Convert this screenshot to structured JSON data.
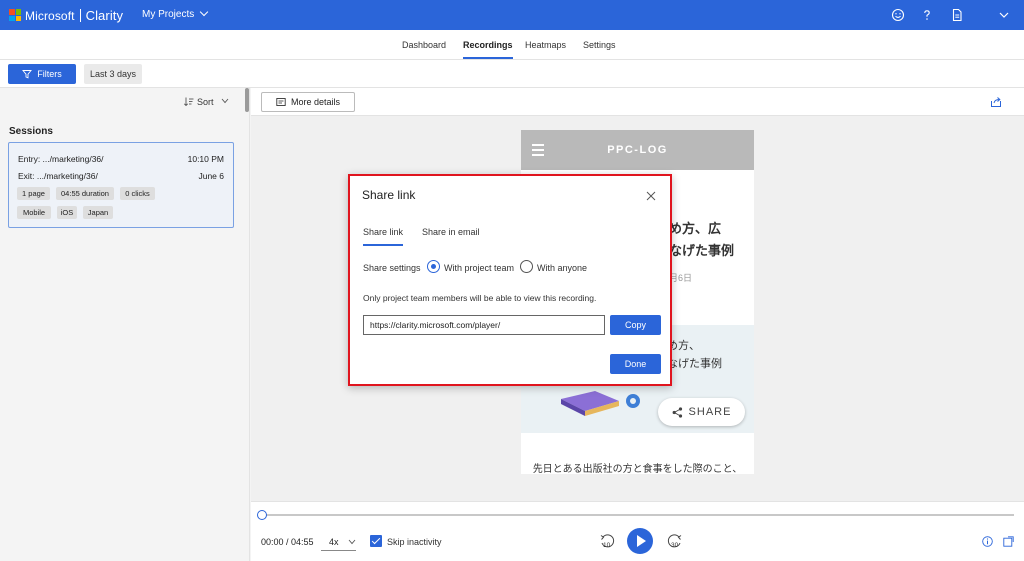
{
  "app": {
    "brand_left": "Microsoft",
    "brand_right": "Clarity",
    "project_menu": "My Projects",
    "accent_color": "#2b65d9"
  },
  "top_icons": [
    "smiley-icon",
    "help-icon",
    "document-icon",
    "chevron-down-icon"
  ],
  "nav": {
    "tabs": [
      {
        "label": "Dashboard"
      },
      {
        "label": "Recordings",
        "active": true
      },
      {
        "label": "Heatmaps"
      },
      {
        "label": "Settings"
      }
    ]
  },
  "filters": {
    "filters_label": "Filters",
    "date_label": "Last 3 days"
  },
  "sessions": {
    "sort_label": "Sort",
    "title": "Sessions",
    "card": {
      "entry": "Entry: .../marketing/36/",
      "entry_time": "10:10 PM",
      "exit": "Exit: .../marketing/36/",
      "exit_date": "June 6",
      "chips_row1": [
        "1 page",
        "04:55 duration",
        "0 clicks"
      ],
      "chips_row2": [
        "Mobile",
        "iOS",
        "Japan"
      ]
    }
  },
  "toolbar": {
    "more_details_label": "More details"
  },
  "preview": {
    "site_title": "PPC-LOG",
    "heading_line1": "め方、広",
    "heading_line2": "なげた事例",
    "date_fragment": "月6日",
    "image_text_line1": "め方、",
    "image_text_line2": "なげた事例",
    "share_label": "SHARE",
    "body_text": "先日とある出版社の方と食事をした際のこと、"
  },
  "modal": {
    "title": "Share link",
    "tabs": [
      {
        "label": "Share link",
        "active": true
      },
      {
        "label": "Share in email"
      }
    ],
    "share_settings_label": "Share settings",
    "options": [
      {
        "label": "With project team",
        "selected": true
      },
      {
        "label": "With anyone",
        "selected": false
      }
    ],
    "info_text": "Only project team members will be able to view this recording.",
    "url_value": "https://clarity.microsoft.com/player/",
    "copy_label": "Copy",
    "done_label": "Done",
    "highlight_color": "#e0141e"
  },
  "player": {
    "time": "00:00 / 04:55",
    "speed": "4x",
    "skip_label": "Skip inactivity",
    "skip_back": "10",
    "skip_forward": "30",
    "progress": 0
  }
}
